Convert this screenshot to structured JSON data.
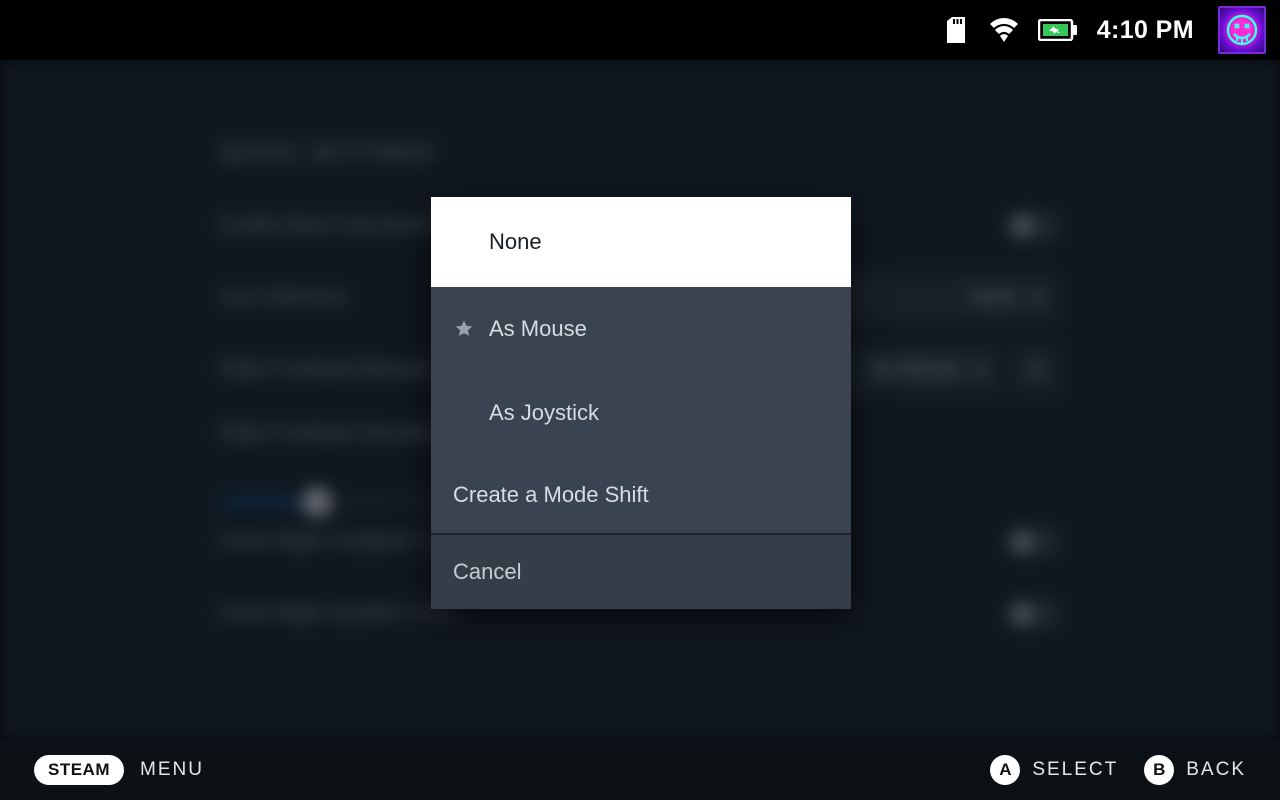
{
  "status": {
    "time": "4:10 PM"
  },
  "settings": {
    "header": "QUICK SETTINGS",
    "rows": {
      "back_grip": "Enable Back Grip Buttons",
      "gyro": "Gyro Behavior",
      "rt_behavior": "Right Trackpad Behavior",
      "rt_sensitivity": "Right Trackpad Sensitivity",
      "invert_rt_y": "Invert Right Trackpad Y-Axis",
      "invert_rj_y": "Invert Right Joystick Y-Axis"
    },
    "gyro_value": "None",
    "rt_value": "As Mouse"
  },
  "modal": {
    "options": {
      "none": "None",
      "as_mouse": "As Mouse",
      "as_joystick": "As Joystick"
    },
    "mode_shift": "Create a Mode Shift",
    "cancel": "Cancel"
  },
  "footer": {
    "steam": "STEAM",
    "menu": "MENU",
    "a_glyph": "A",
    "a_label": "SELECT",
    "b_glyph": "B",
    "b_label": "BACK"
  }
}
